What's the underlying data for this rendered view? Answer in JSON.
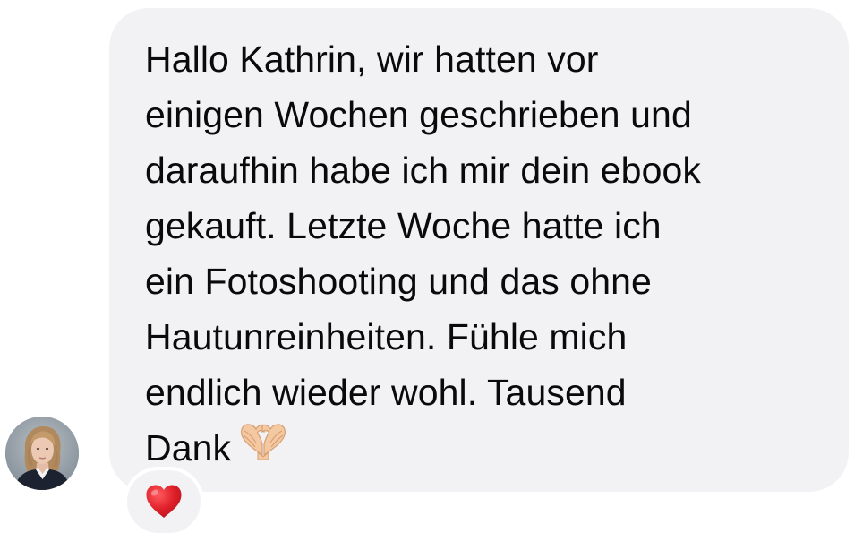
{
  "message": {
    "lines": [
      "Hallo Kathrin, wir hatten vor",
      "einigen Wochen geschrieben und",
      "daraufhin habe ich mir dein ebook",
      "gekauft. Letzte Woche hatte ich",
      "ein Fotoshooting und das ohne",
      "Hautunreinheiten. Fühle mich",
      "endlich wieder wohl. Tausend",
      "Dank"
    ],
    "emoji": "heart-hands-emoji"
  },
  "avatar": {
    "icon": "user-avatar-photo"
  },
  "reaction": {
    "icon": "red-heart-icon",
    "color": "#e0202a"
  },
  "colors": {
    "bubble": "#f2f2f5",
    "text": "#0a0a0a",
    "background": "#ffffff"
  }
}
